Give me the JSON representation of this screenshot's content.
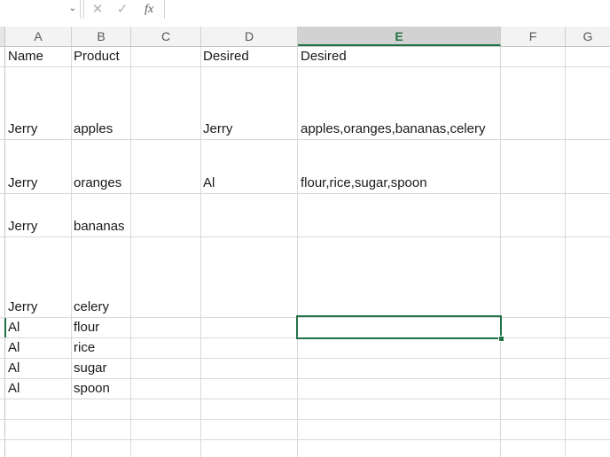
{
  "formula_bar": {
    "cancel_icon": "✕",
    "enter_icon": "✓",
    "fx_label": "fx",
    "formula_value": ""
  },
  "columns": [
    "A",
    "B",
    "C",
    "D",
    "E",
    "F",
    "G"
  ],
  "selected_column": "E",
  "cells": {
    "A1": "Name",
    "B1": "Product",
    "D1": "Desired",
    "E1": "Desired",
    "A2": "Jerry",
    "B2": "apples",
    "D2": "Jerry",
    "E2": "apples,oranges,bananas,celery",
    "A3": "Jerry",
    "B3": "oranges",
    "D3": "Al",
    "E3": "flour,rice,sugar,spoon",
    "A4": "Jerry",
    "B4": "bananas",
    "A5": "Jerry",
    "B5": "celery",
    "A6": "Al",
    "B6": "flour",
    "A7": "Al",
    "B7": "rice",
    "A8": "Al",
    "B8": "sugar",
    "A9": "Al",
    "B9": "spoon"
  },
  "colors": {
    "accent": "#217346",
    "gridline": "#d9d9d9",
    "header_bg": "#f3f3f3"
  }
}
